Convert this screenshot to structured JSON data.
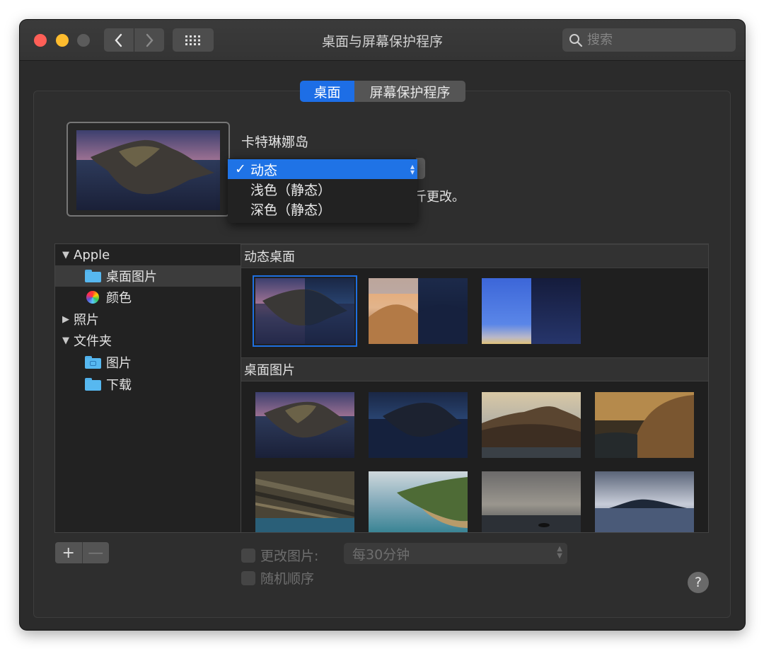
{
  "window": {
    "title": "桌面与屏幕保护程序",
    "search_placeholder": "搜索"
  },
  "tabs": [
    {
      "label": "桌面",
      "selected": true
    },
    {
      "label": "屏幕保护程序",
      "selected": false
    }
  ],
  "wallpaper": {
    "name": "卡特琳娜岛",
    "partial_text": "斤更改。"
  },
  "appearance_menu": {
    "items": [
      {
        "label": "动态",
        "checked": true,
        "check": "✓"
      },
      {
        "label": "浅色（静态）",
        "checked": false
      },
      {
        "label": "深色（静态）",
        "checked": false
      }
    ]
  },
  "sidebar": {
    "apple_group": "Apple",
    "apple_items": [
      "桌面图片",
      "颜色"
    ],
    "photos": "照片",
    "folders_group": "文件夹",
    "folder_items": [
      "图片",
      "下载"
    ]
  },
  "content": {
    "dynamic_section": "动态桌面",
    "pictures_section": "桌面图片",
    "dynamic_thumbs": [
      "catalina-dynamic",
      "mojave-dynamic",
      "solar-gradients-dynamic"
    ],
    "picture_thumbs": [
      "catalina-day",
      "catalina-night",
      "catalina-coast-1",
      "catalina-coast-2",
      "catalina-rocks",
      "catalina-shore",
      "catalina-clouds",
      "catalina-evening"
    ]
  },
  "bottom": {
    "add_label": "+",
    "remove_label": "—",
    "change_picture_label": "更改图片:",
    "interval_value": "每30分钟",
    "random_order_label": "随机顺序",
    "help_label": "?"
  },
  "colors": {
    "accent": "#1f73e6",
    "window_bg": "#2b2b2b",
    "close": "#ff5f57",
    "minimize": "#febc2e"
  }
}
